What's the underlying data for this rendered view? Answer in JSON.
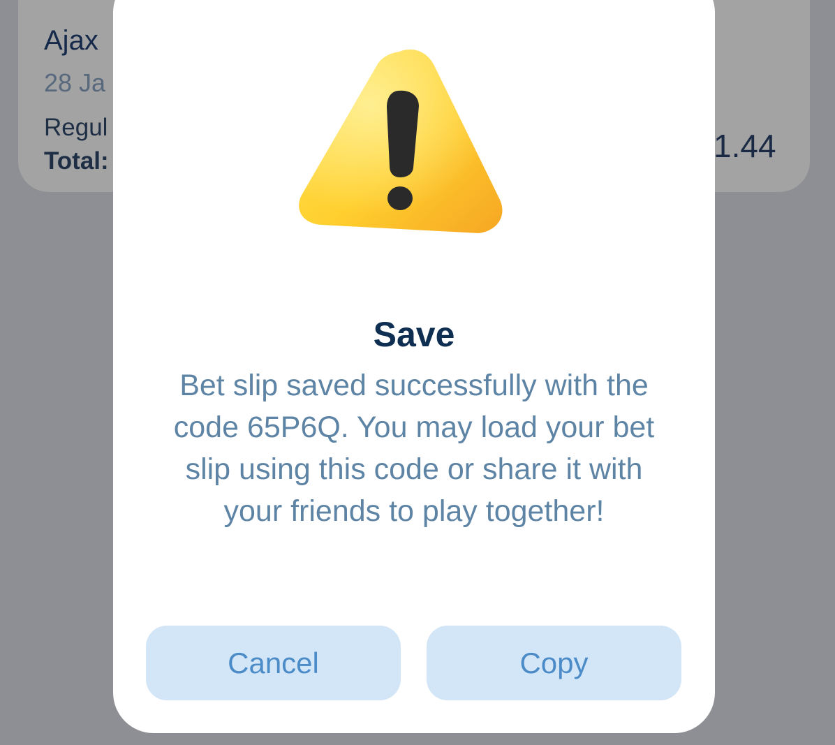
{
  "background_card": {
    "team": "Ajax",
    "date": "28 Ja",
    "bet_type": "Regul",
    "total_label": "Total:",
    "odds": "1.44"
  },
  "dialog": {
    "icon": "warning-icon",
    "title": "Save",
    "message": "Bet slip saved successfully with the code 65P6Q. You may load your bet slip using this code or share it with your friends to play together!",
    "cancel_label": "Cancel",
    "copy_label": "Copy"
  },
  "colors": {
    "overlay": "#8e8f94",
    "title": "#0e2f52",
    "message": "#5e84a5",
    "button_bg": "#d3e6f8",
    "button_text": "#4b8bc7",
    "warning_yellow": "#ffcf2e"
  }
}
